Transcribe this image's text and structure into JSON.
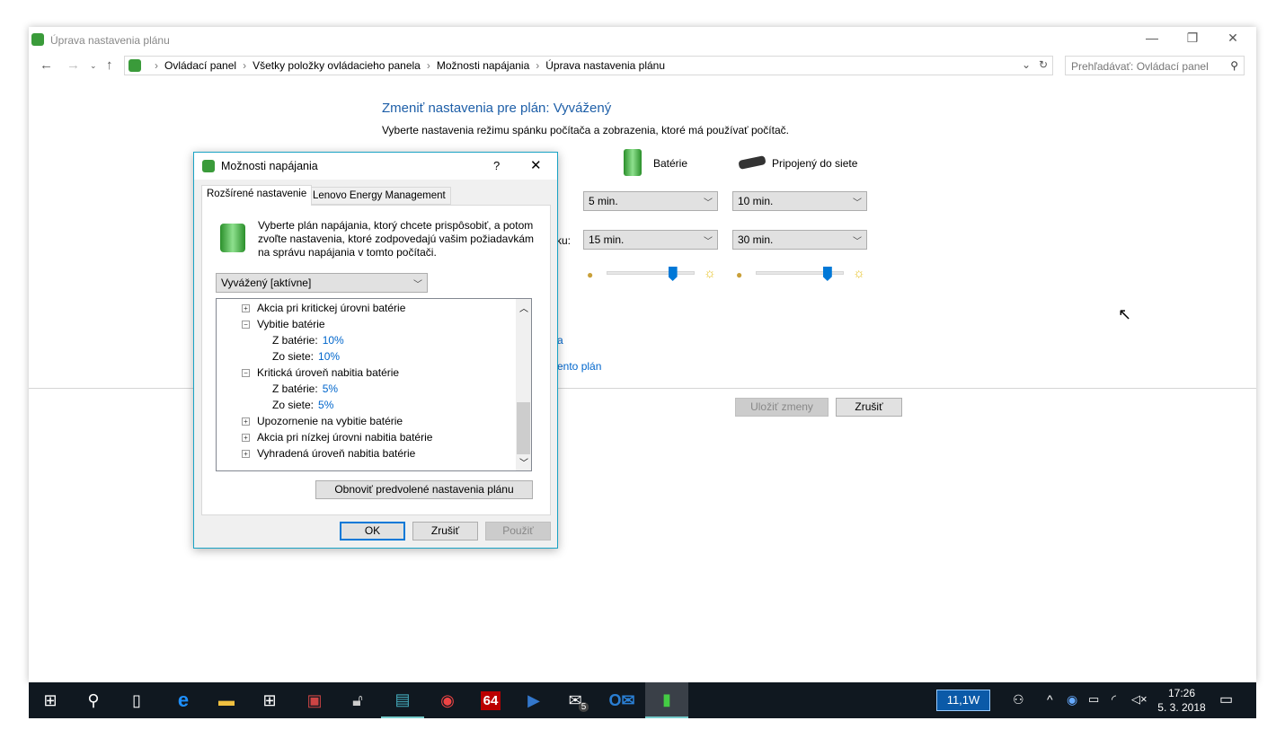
{
  "window": {
    "title": "Úprava nastavenia plánu",
    "breadcrumb": [
      "Ovládací panel",
      "Všetky položky ovládacieho panela",
      "Možnosti napájania",
      "Úprava nastavenia plánu"
    ],
    "search_placeholder": "Prehľadávať: Ovládací panel"
  },
  "main": {
    "heading": "Zmeniť nastavenia pre plán: Vyvážený",
    "subtitle": "Vyberte nastavenia režimu spánku počítača a zobrazenia, ktoré má používať počítač.",
    "col_battery": "Batérie",
    "col_plugged": "Pripojený do siete",
    "row2_label_fragment": "ku:",
    "display_off_battery": "5 min.",
    "display_off_plugged": "10 min.",
    "sleep_battery": "15 min.",
    "sleep_plugged": "30 min.",
    "brightness_battery_pct": 78,
    "brightness_plugged_pct": 85,
    "link1_fragment": "a",
    "link2_fragment": "ento plán",
    "save_label": "Uložiť zmeny",
    "cancel_label": "Zrušiť"
  },
  "dialog": {
    "title": "Možnosti napájania",
    "help": "?",
    "tabs": [
      "Rozšírené nastavenie",
      "Lenovo Energy Management"
    ],
    "description": "Vyberte plán napájania, ktorý chcete prispôsobiť, a potom zvoľte nastavenia, ktoré zodpovedajú vašim požiadavkám na správu napájania v tomto počítači.",
    "plan": "Vyvážený [aktívne]",
    "tree": [
      {
        "label": "Akcia pri kritickej úrovni batérie",
        "level": 1,
        "toggle": "+"
      },
      {
        "label": "Vybitie batérie",
        "level": 1,
        "toggle": "−"
      },
      {
        "label": "Z batérie:",
        "value": "10%",
        "level": 2
      },
      {
        "label": "Zo siete:",
        "value": "10%",
        "level": 2
      },
      {
        "label": "Kritická úroveň nabitia batérie",
        "level": 1,
        "toggle": "−"
      },
      {
        "label": "Z batérie:",
        "value": "5%",
        "level": 2
      },
      {
        "label": "Zo siete:",
        "value": "5%",
        "level": 2
      },
      {
        "label": "Upozornenie na vybitie batérie",
        "level": 1,
        "toggle": "+"
      },
      {
        "label": "Akcia pri nízkej úrovni nabitia batérie",
        "level": 1,
        "toggle": "+"
      },
      {
        "label": "Vyhradená úroveň nabitia batérie",
        "level": 1,
        "toggle": "+"
      }
    ],
    "restore_label": "Obnoviť predvolené nastavenia plánu",
    "ok": "OK",
    "cancel": "Zrušiť",
    "apply": "Použiť"
  },
  "taskbar": {
    "power": "11,1W",
    "time": "17:26",
    "date": "5. 3. 2018",
    "mail_badge": "5",
    "app64": "64"
  }
}
